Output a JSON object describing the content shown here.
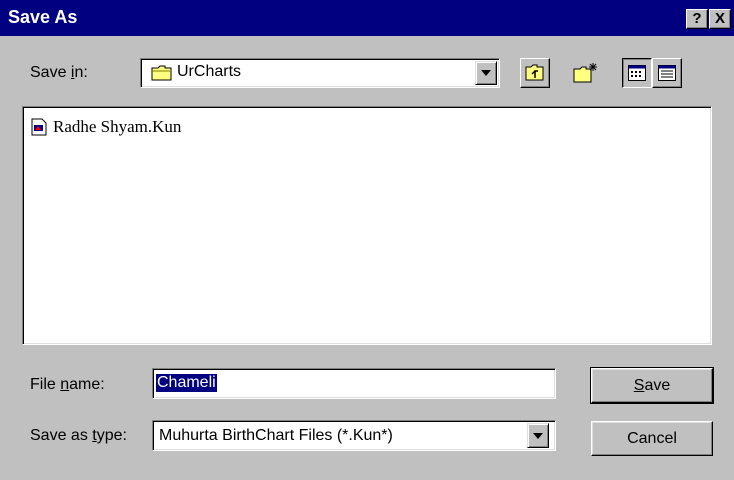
{
  "window": {
    "title": "Save As",
    "help_button": "?",
    "close_button": "X"
  },
  "save_in": {
    "label_pre": "Save ",
    "label_hotkey": "i",
    "label_post": "n:",
    "folder": "UrCharts"
  },
  "file_list": {
    "items": [
      {
        "name": "Radhe Shyam.Kun"
      }
    ]
  },
  "file_name": {
    "label_pre": "File ",
    "label_hotkey": "n",
    "label_post": "ame:",
    "value": "Chameli"
  },
  "save_as_type": {
    "label_pre": "Save as ",
    "label_hotkey": "t",
    "label_post": "ype:",
    "value": "Muhurta BirthChart Files (*.Kun*)"
  },
  "buttons": {
    "save_hotkey": "S",
    "save_rest": "ave",
    "cancel": "Cancel"
  },
  "toolbar": {
    "up_one_level": "up-one-level-icon",
    "create_new_folder": "new-folder-icon",
    "list_view": "list-view-icon",
    "details_view": "details-view-icon"
  },
  "colors": {
    "titlebar": "#000080",
    "face": "#c0c0c0",
    "selection": "#000080"
  }
}
